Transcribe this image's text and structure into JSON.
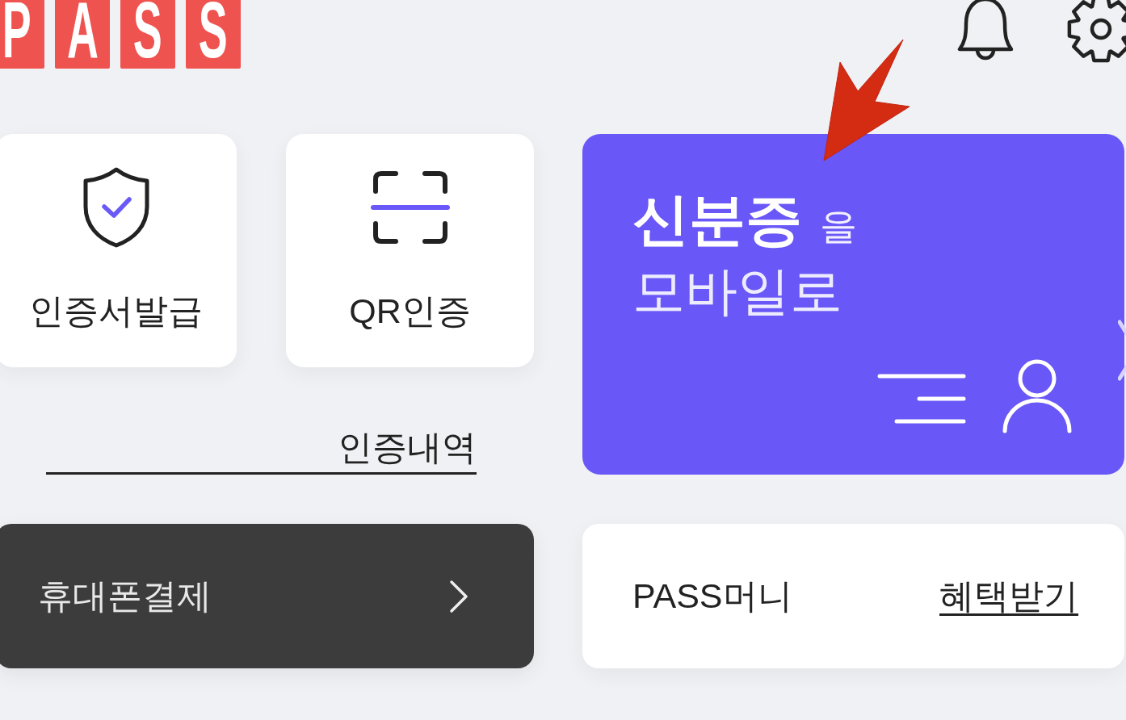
{
  "logo": {
    "letters": [
      "P",
      "A",
      "S",
      "S"
    ]
  },
  "quick_actions": [
    {
      "kind": "shield",
      "label": "인증서발급"
    },
    {
      "kind": "scan",
      "label": "QR인증"
    }
  ],
  "history_link": {
    "label": "인증내역"
  },
  "phone_payment": {
    "label": "휴대폰결제"
  },
  "id_card": {
    "title": "신분증",
    "title_suffix": "을",
    "subtitle": "모바일로"
  },
  "pass_money": {
    "label": "PASS머니",
    "link": "혜택받기"
  }
}
